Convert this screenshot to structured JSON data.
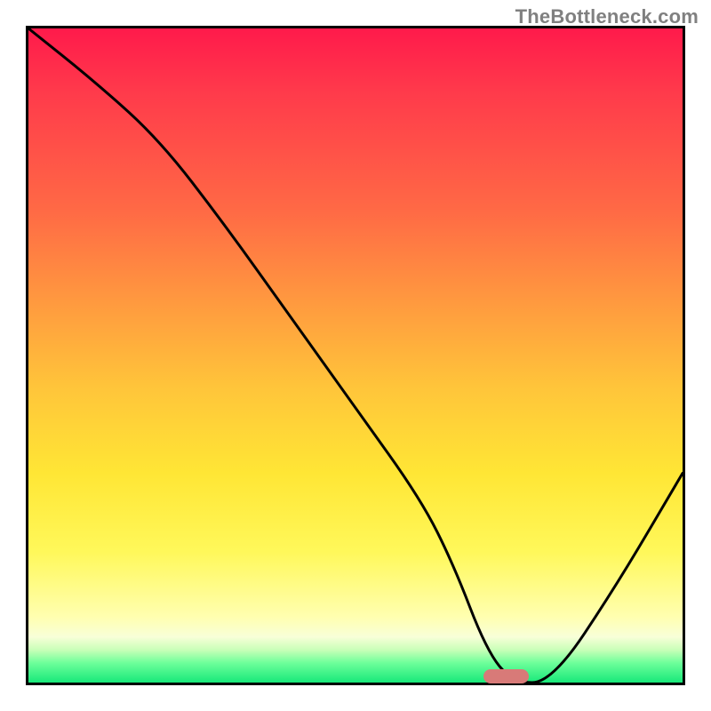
{
  "watermark": "TheBottleneck.com",
  "chart_data": {
    "type": "line",
    "title": "",
    "xlabel": "",
    "ylabel": "",
    "xlim": [
      0,
      100
    ],
    "ylim": [
      0,
      100
    ],
    "grid": false,
    "series": [
      {
        "name": "bottleneck-curve",
        "x": [
          0,
          10,
          20,
          30,
          40,
          50,
          60,
          65,
          70,
          74,
          80,
          90,
          100
        ],
        "y": [
          100,
          92,
          83,
          70,
          56,
          42,
          28,
          18,
          5,
          0,
          0,
          15,
          32
        ]
      }
    ],
    "marker": {
      "x_center": 73,
      "y": 1.0,
      "width_pct": 7
    },
    "gradient_stops": [
      {
        "pct": 0,
        "color": "#ff1a4b"
      },
      {
        "pct": 28,
        "color": "#ff6a45"
      },
      {
        "pct": 55,
        "color": "#ffc53a"
      },
      {
        "pct": 80,
        "color": "#fff85a"
      },
      {
        "pct": 93,
        "color": "#f8ffd8"
      },
      {
        "pct": 100,
        "color": "#18e87a"
      }
    ]
  }
}
